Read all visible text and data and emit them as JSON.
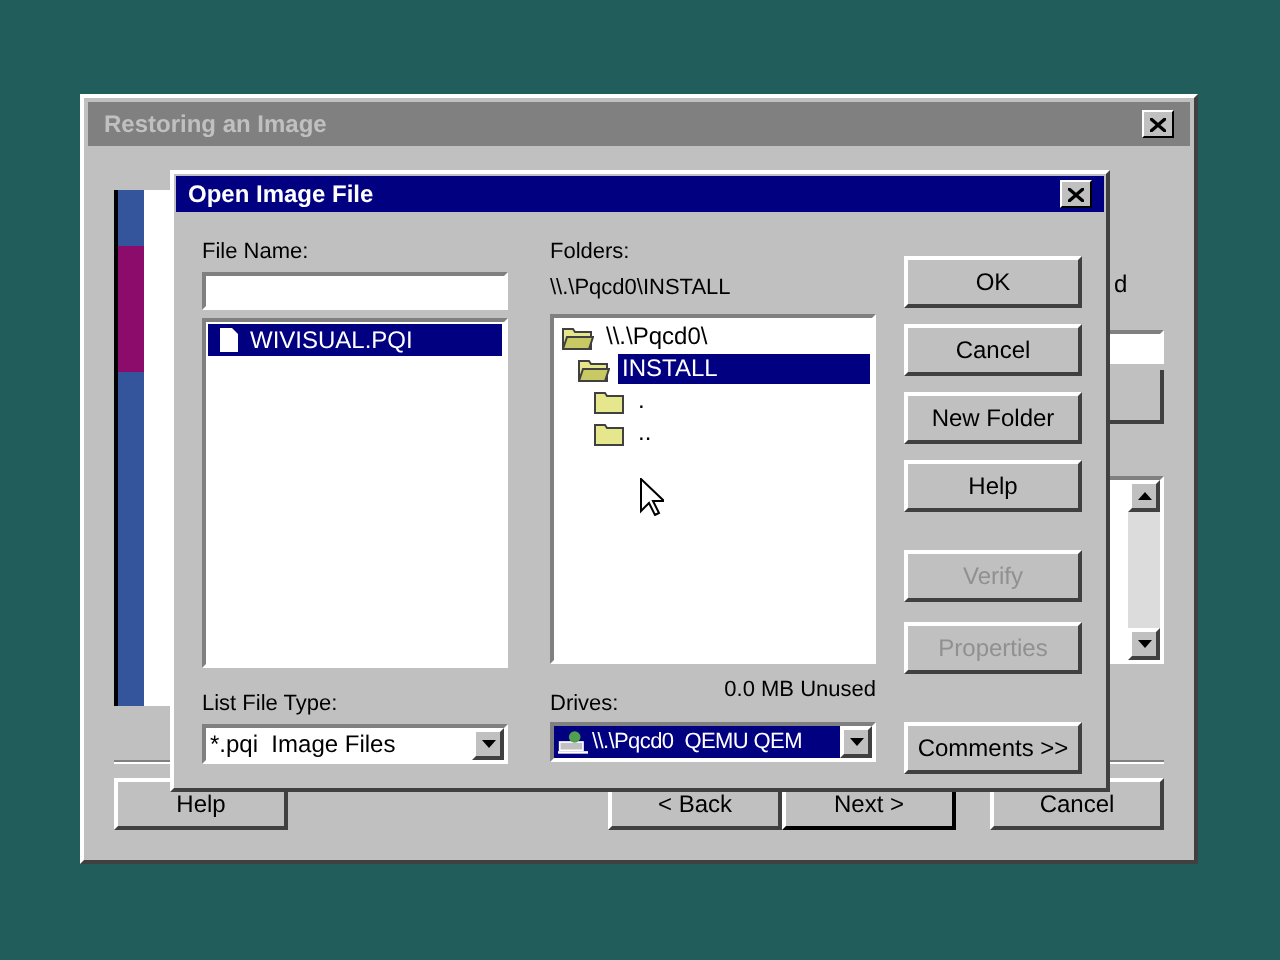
{
  "back_window": {
    "title": "Restoring an Image",
    "partial_label": "d",
    "buttons": [
      {
        "label": "Help",
        "kind": "left"
      },
      {
        "label": "< Back",
        "kind": "right"
      },
      {
        "label": "Next >",
        "kind": "right"
      },
      {
        "label": "Cancel",
        "kind": "cancel"
      }
    ]
  },
  "dialog": {
    "title": "Open Image File",
    "file_name": {
      "label": "File Name:"
    },
    "files": [
      {
        "name": "WIVISUAL.PQI",
        "selected": true
      }
    ],
    "list_file_type": {
      "label": "List File Type:",
      "value": "*.pqi  Image Files"
    },
    "folders": {
      "label": "Folders:",
      "path": "\\\\.\\Pqcd0\\INSTALL",
      "tree": [
        {
          "name": "\\\\.\\Pqcd0\\",
          "kind": "open",
          "selected": false,
          "children": [
            {
              "name": "INSTALL",
              "kind": "open",
              "selected": true,
              "children": [
                {
                  "name": ".",
                  "kind": "closed",
                  "selected": false
                },
                {
                  "name": "..",
                  "kind": "closed",
                  "selected": false
                }
              ]
            }
          ]
        }
      ]
    },
    "drives": {
      "label": "Drives:",
      "free": "0.0 MB Unused",
      "value": "\\\\.\\Pqcd0  QEMU QEM"
    },
    "buttons": [
      {
        "label": "OK",
        "disabled": false
      },
      {
        "label": "Cancel",
        "disabled": false
      },
      {
        "label": "New Folder",
        "disabled": false
      },
      {
        "label": "Help",
        "disabled": false
      },
      {
        "label": "Verify",
        "disabled": true
      },
      {
        "label": "Properties",
        "disabled": true
      },
      {
        "label": "Comments >>",
        "disabled": false
      }
    ]
  }
}
